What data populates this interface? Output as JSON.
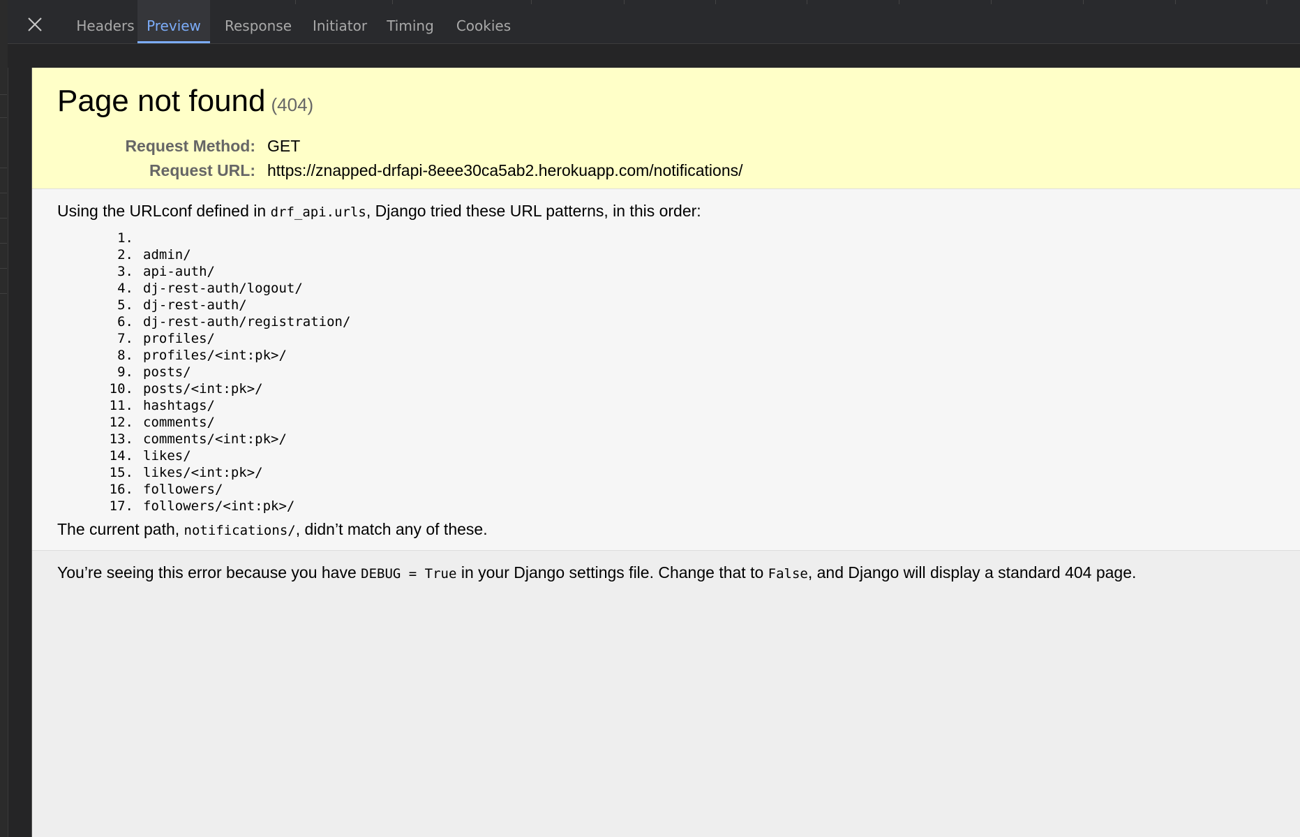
{
  "devtools": {
    "tabs": [
      {
        "label": "Headers",
        "active": false
      },
      {
        "label": "Preview",
        "active": true
      },
      {
        "label": "Response",
        "active": false
      },
      {
        "label": "Initiator",
        "active": false
      },
      {
        "label": "Timing",
        "active": false
      },
      {
        "label": "Cookies",
        "active": false
      }
    ],
    "accent_color": "#7cacf8"
  },
  "page": {
    "title": "Page not found",
    "status_code": "(404)",
    "request_method_label": "Request Method:",
    "request_method": "GET",
    "request_url_label": "Request URL:",
    "request_url": "https://znapped-drfapi-8eee30ca5ab2.herokuapp.com/notifications/",
    "urlconf_prefix": "Using the URLconf defined in ",
    "urlconf_module": "drf_api.urls",
    "urlconf_suffix": ", Django tried these URL patterns, in this order:",
    "patterns": [
      {
        "num": "1.",
        "path": ""
      },
      {
        "num": "2.",
        "path": "admin/"
      },
      {
        "num": "3.",
        "path": "api-auth/"
      },
      {
        "num": "4.",
        "path": "dj-rest-auth/logout/"
      },
      {
        "num": "5.",
        "path": "dj-rest-auth/"
      },
      {
        "num": "6.",
        "path": "dj-rest-auth/registration/"
      },
      {
        "num": "7.",
        "path": "profiles/"
      },
      {
        "num": "8.",
        "path": "profiles/<int:pk>/"
      },
      {
        "num": "9.",
        "path": "posts/"
      },
      {
        "num": "10.",
        "path": "posts/<int:pk>/"
      },
      {
        "num": "11.",
        "path": "hashtags/"
      },
      {
        "num": "12.",
        "path": "comments/"
      },
      {
        "num": "13.",
        "path": "comments/<int:pk>/"
      },
      {
        "num": "14.",
        "path": "likes/"
      },
      {
        "num": "15.",
        "path": "likes/<int:pk>/"
      },
      {
        "num": "16.",
        "path": "followers/"
      },
      {
        "num": "17.",
        "path": "followers/<int:pk>/"
      }
    ],
    "current_path_prefix": "The current path, ",
    "current_path": "notifications/",
    "current_path_suffix": ", didn’t match any of these.",
    "debug_prefix": "You’re seeing this error because you have ",
    "debug_setting": "DEBUG = True",
    "debug_middle": " in your Django settings file. Change that to ",
    "debug_false": "False",
    "debug_suffix": ", and Django will display a standard 404 page."
  }
}
